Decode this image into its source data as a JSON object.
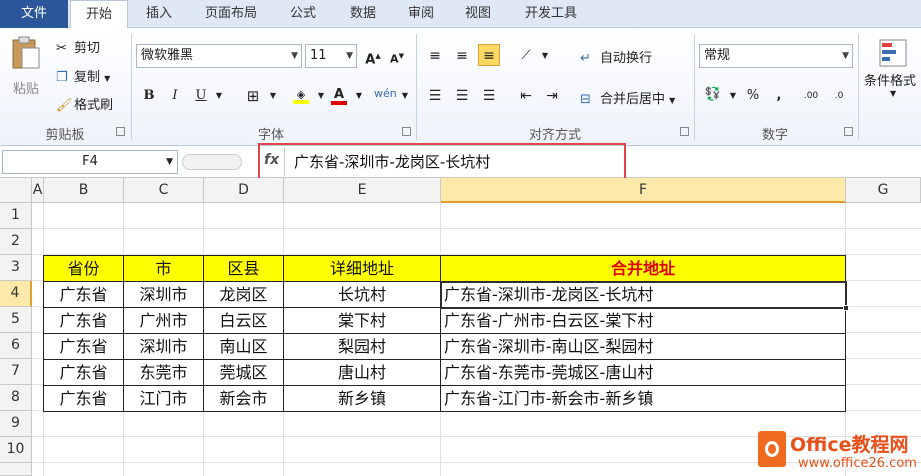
{
  "tabs": [
    {
      "label": "文件"
    },
    {
      "label": "开始"
    },
    {
      "label": "插入"
    },
    {
      "label": "页面布局"
    },
    {
      "label": "公式"
    },
    {
      "label": "数据"
    },
    {
      "label": "审阅"
    },
    {
      "label": "视图"
    },
    {
      "label": "开发工具"
    }
  ],
  "ribbon": {
    "clipboard": {
      "paste": "粘贴",
      "cut": "剪切",
      "copy": "复制",
      "format_painter": "格式刷",
      "label": "剪贴板"
    },
    "font": {
      "family": "微软雅黑",
      "size": "11",
      "label": "字体"
    },
    "alignment": {
      "wrap_text": "自动换行",
      "merge_center": "合并后居中",
      "label": "对齐方式"
    },
    "number": {
      "format": "常规",
      "label": "数字"
    },
    "styles": {
      "cond_format": "条件格式"
    }
  },
  "formula_bar": {
    "name_box": "F4",
    "fx": "fx",
    "content": "广东省-深圳市-龙岗区-长坑村"
  },
  "sheet": {
    "columns": [
      "A",
      "B",
      "C",
      "D",
      "E",
      "F",
      "G"
    ],
    "rows": [
      "1",
      "2",
      "3",
      "4",
      "5",
      "6",
      "7",
      "8",
      "9",
      "10"
    ],
    "headers": [
      "省份",
      "市",
      "区县",
      "详细地址",
      "合并地址"
    ],
    "data": [
      [
        "广东省",
        "深圳市",
        "龙岗区",
        "长坑村",
        "广东省-深圳市-龙岗区-长坑村"
      ],
      [
        "广东省",
        "广州市",
        "白云区",
        "棠下村",
        "广东省-广州市-白云区-棠下村"
      ],
      [
        "广东省",
        "深圳市",
        "南山区",
        "梨园村",
        "广东省-深圳市-南山区-梨园村"
      ],
      [
        "广东省",
        "东莞市",
        "莞城区",
        "唐山村",
        "广东省-东莞市-莞城区-唐山村"
      ],
      [
        "广东省",
        "江门市",
        "新会市",
        "新乡镇",
        "广东省-江门市-新会市-新乡镇"
      ]
    ],
    "active_cell": "F4"
  },
  "watermark": {
    "title": "Office教程网",
    "url": "www.office26.com"
  },
  "colors": {
    "file_tab": "#2b579a",
    "header_fill": "#ffff00",
    "highlight_red": "#e00000",
    "selection": "#fde9a9"
  }
}
